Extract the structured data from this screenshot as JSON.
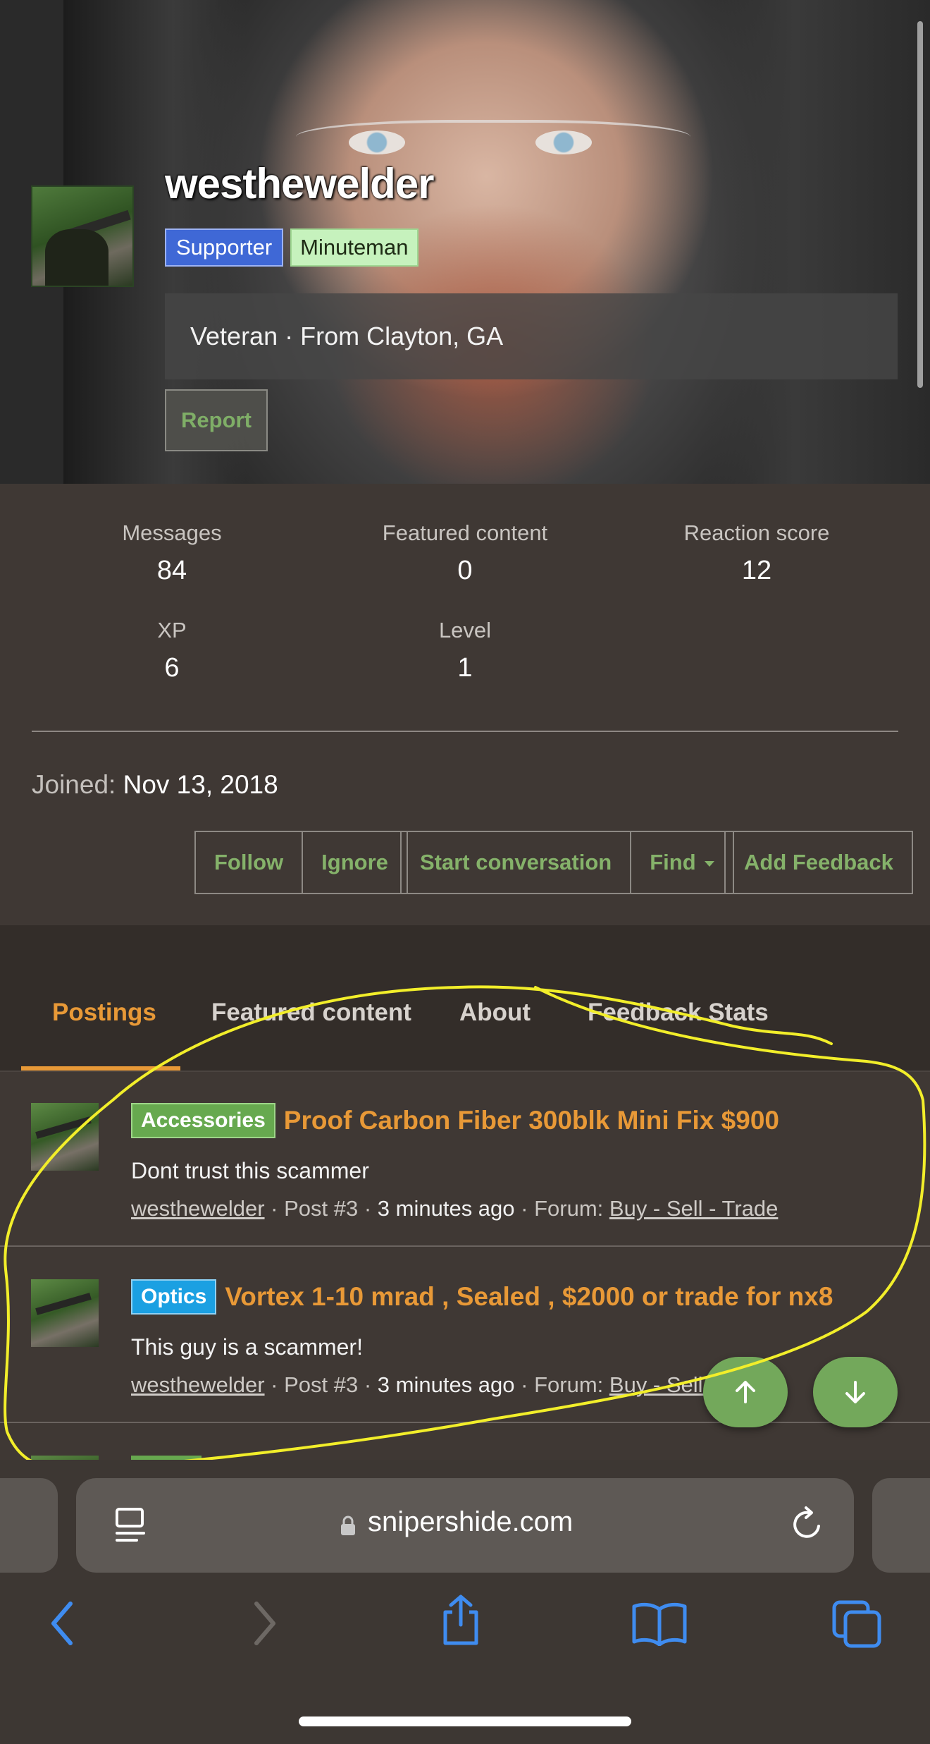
{
  "profile": {
    "username": "westhewelder",
    "badges": {
      "supporter": "Supporter",
      "minuteman": "Minuteman"
    },
    "tagline": "Veteran · From Clayton, GA",
    "report_label": "Report"
  },
  "stats": {
    "messages": {
      "label": "Messages",
      "value": "84"
    },
    "featured": {
      "label": "Featured content",
      "value": "0"
    },
    "reaction": {
      "label": "Reaction score",
      "value": "12"
    },
    "xp": {
      "label": "XP",
      "value": "6"
    },
    "level": {
      "label": "Level",
      "value": "1"
    }
  },
  "joined": {
    "label": "Joined:",
    "value": "Nov 13, 2018"
  },
  "actions": {
    "follow": "Follow",
    "ignore": "Ignore",
    "start_conversation": "Start conversation",
    "find": "Find",
    "add_feedback": "Add Feedback"
  },
  "tabs": {
    "postings": "Postings",
    "featured": "Featured content",
    "about": "About",
    "feedback": "Feedback Stats",
    "active": "Postings"
  },
  "posts": [
    {
      "prefix": "Accessories",
      "title": "Proof Carbon Fiber 300blk Mini Fix $900",
      "snippet": "Dont trust this scammer",
      "author": "westhewelder",
      "post_no": "Post #3",
      "time": "3 minutes ago",
      "forum_label": "Forum:",
      "forum": "Buy - Sell - Trade"
    },
    {
      "prefix": "Optics",
      "title": "Vortex 1-10 mrad , Sealed , $2000 or trade for nx8",
      "snippet": "This guy is a scammer!",
      "author": "westhewelder",
      "post_no": "Post #3",
      "time": "3 minutes ago",
      "forum_label": "Forum:",
      "forum": "Buy - Sell - Trade"
    }
  ],
  "browser": {
    "url": "snipershide.com"
  },
  "icons": {
    "reader": "reader-mode-icon",
    "lock": "lock-icon",
    "reload": "reload-icon",
    "back": "back-arrow-icon",
    "forward": "forward-arrow-icon",
    "share": "share-icon",
    "bookmarks": "bookmarks-icon",
    "tabs": "tabs-icon",
    "scroll_up": "arrow-up-icon",
    "scroll_down": "arrow-down-icon"
  },
  "colors": {
    "accent_orange": "#e89937",
    "button_green": "#85b26a",
    "annotation_yellow": "#f2ee2a",
    "ios_blue": "#3f8cf0"
  }
}
